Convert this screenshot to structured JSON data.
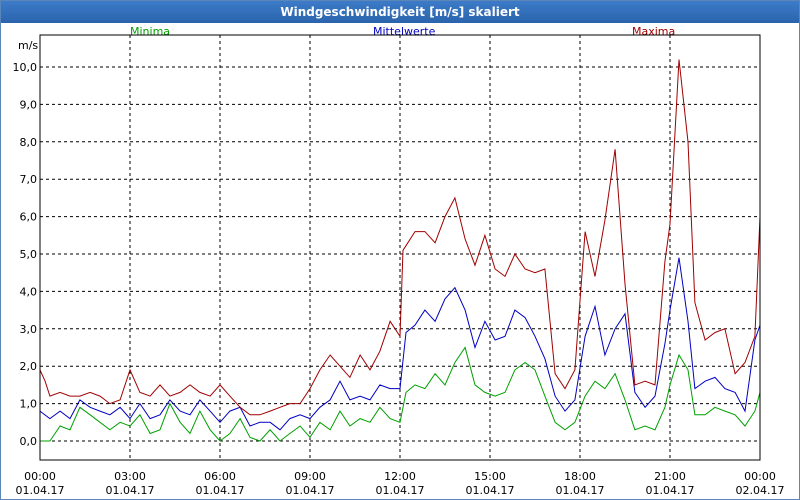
{
  "window": {
    "title": "Windgeschwindigkeit [m/s] skaliert"
  },
  "chart_data": {
    "type": "line",
    "title": "Windgeschwindigkeit [m/s] skaliert",
    "ylabel": "m/s",
    "ylim": [
      0,
      10.5
    ],
    "xlim": [
      0,
      24
    ],
    "yticks": [
      {
        "value": 0,
        "label": "0,0"
      },
      {
        "value": 1,
        "label": "1,0"
      },
      {
        "value": 2,
        "label": "2,0"
      },
      {
        "value": 3,
        "label": "3,0"
      },
      {
        "value": 4,
        "label": "4,0"
      },
      {
        "value": 5,
        "label": "5,0"
      },
      {
        "value": 6,
        "label": "6,0"
      },
      {
        "value": 7,
        "label": "7,0"
      },
      {
        "value": 8,
        "label": "8,0"
      },
      {
        "value": 9,
        "label": "9,0"
      },
      {
        "value": 10,
        "label": "10,0"
      }
    ],
    "xticks": [
      {
        "hour": 0,
        "time": "00:00",
        "date": "01.04.17"
      },
      {
        "hour": 3,
        "time": "03:00",
        "date": "01.04.17"
      },
      {
        "hour": 6,
        "time": "06:00",
        "date": "01.04.17"
      },
      {
        "hour": 9,
        "time": "09:00",
        "date": "01.04.17"
      },
      {
        "hour": 12,
        "time": "12:00",
        "date": "01.04.17"
      },
      {
        "hour": 15,
        "time": "15:00",
        "date": "01.04.17"
      },
      {
        "hour": 18,
        "time": "18:00",
        "date": "01.04.17"
      },
      {
        "hour": 21,
        "time": "21:00",
        "date": "01.04.17"
      },
      {
        "hour": 24,
        "time": "00:00",
        "date": "02.04.17"
      }
    ],
    "grid": true,
    "legend": "top",
    "series": [
      {
        "name": "Minima",
        "color": "#00a000",
        "points": [
          [
            0,
            0.0
          ],
          [
            0.33,
            0.0
          ],
          [
            0.67,
            0.4
          ],
          [
            1.0,
            0.3
          ],
          [
            1.33,
            0.9
          ],
          [
            1.67,
            0.7
          ],
          [
            2.0,
            0.5
          ],
          [
            2.33,
            0.3
          ],
          [
            2.67,
            0.5
          ],
          [
            3.0,
            0.4
          ],
          [
            3.33,
            0.7
          ],
          [
            3.67,
            0.2
          ],
          [
            4.0,
            0.3
          ],
          [
            4.33,
            1.0
          ],
          [
            4.67,
            0.5
          ],
          [
            5.0,
            0.2
          ],
          [
            5.33,
            0.8
          ],
          [
            5.67,
            0.3
          ],
          [
            6.0,
            0.0
          ],
          [
            6.33,
            0.2
          ],
          [
            6.67,
            0.6
          ],
          [
            7.0,
            0.1
          ],
          [
            7.33,
            0.0
          ],
          [
            7.67,
            0.3
          ],
          [
            8.0,
            0.0
          ],
          [
            8.33,
            0.2
          ],
          [
            8.67,
            0.4
          ],
          [
            9.0,
            0.1
          ],
          [
            9.33,
            0.5
          ],
          [
            9.67,
            0.3
          ],
          [
            10.0,
            0.8
          ],
          [
            10.33,
            0.4
          ],
          [
            10.67,
            0.6
          ],
          [
            11.0,
            0.5
          ],
          [
            11.33,
            0.9
          ],
          [
            11.67,
            0.6
          ],
          [
            12.0,
            0.5
          ],
          [
            12.2,
            1.3
          ],
          [
            12.5,
            1.5
          ],
          [
            12.83,
            1.4
          ],
          [
            13.17,
            1.8
          ],
          [
            13.5,
            1.5
          ],
          [
            13.83,
            2.1
          ],
          [
            14.17,
            2.5
          ],
          [
            14.5,
            1.5
          ],
          [
            14.83,
            1.3
          ],
          [
            15.17,
            1.2
          ],
          [
            15.5,
            1.3
          ],
          [
            15.83,
            1.9
          ],
          [
            16.17,
            2.1
          ],
          [
            16.5,
            1.9
          ],
          [
            16.83,
            1.2
          ],
          [
            17.17,
            0.5
          ],
          [
            17.5,
            0.3
          ],
          [
            17.83,
            0.5
          ],
          [
            18.17,
            1.2
          ],
          [
            18.5,
            1.6
          ],
          [
            18.83,
            1.4
          ],
          [
            19.17,
            1.8
          ],
          [
            19.5,
            1.1
          ],
          [
            19.83,
            0.3
          ],
          [
            20.17,
            0.4
          ],
          [
            20.5,
            0.3
          ],
          [
            20.83,
            0.9
          ],
          [
            21.0,
            1.5
          ],
          [
            21.3,
            2.3
          ],
          [
            21.6,
            1.9
          ],
          [
            21.83,
            0.7
          ],
          [
            22.17,
            0.7
          ],
          [
            22.5,
            0.9
          ],
          [
            22.83,
            0.8
          ],
          [
            23.17,
            0.7
          ],
          [
            23.5,
            0.4
          ],
          [
            23.83,
            0.8
          ],
          [
            24.0,
            1.3
          ]
        ]
      },
      {
        "name": "Mittelwerte",
        "color": "#0000c0",
        "points": [
          [
            0,
            0.8
          ],
          [
            0.33,
            0.6
          ],
          [
            0.67,
            0.8
          ],
          [
            1.0,
            0.6
          ],
          [
            1.33,
            1.1
          ],
          [
            1.67,
            0.9
          ],
          [
            2.0,
            0.8
          ],
          [
            2.33,
            0.7
          ],
          [
            2.67,
            0.9
          ],
          [
            3.0,
            0.6
          ],
          [
            3.33,
            1.0
          ],
          [
            3.67,
            0.6
          ],
          [
            4.0,
            0.7
          ],
          [
            4.33,
            1.1
          ],
          [
            4.67,
            0.8
          ],
          [
            5.0,
            0.7
          ],
          [
            5.33,
            1.1
          ],
          [
            5.67,
            0.8
          ],
          [
            6.0,
            0.5
          ],
          [
            6.33,
            0.8
          ],
          [
            6.67,
            0.9
          ],
          [
            7.0,
            0.4
          ],
          [
            7.33,
            0.5
          ],
          [
            7.67,
            0.5
          ],
          [
            8.0,
            0.3
          ],
          [
            8.33,
            0.6
          ],
          [
            8.67,
            0.7
          ],
          [
            9.0,
            0.6
          ],
          [
            9.33,
            0.9
          ],
          [
            9.67,
            1.1
          ],
          [
            10.0,
            1.6
          ],
          [
            10.33,
            1.1
          ],
          [
            10.67,
            1.2
          ],
          [
            11.0,
            1.1
          ],
          [
            11.33,
            1.5
          ],
          [
            11.67,
            1.4
          ],
          [
            12.0,
            1.4
          ],
          [
            12.2,
            2.9
          ],
          [
            12.5,
            3.1
          ],
          [
            12.83,
            3.5
          ],
          [
            13.17,
            3.2
          ],
          [
            13.5,
            3.8
          ],
          [
            13.83,
            4.1
          ],
          [
            14.17,
            3.5
          ],
          [
            14.5,
            2.5
          ],
          [
            14.83,
            3.2
          ],
          [
            15.17,
            2.7
          ],
          [
            15.5,
            2.8
          ],
          [
            15.83,
            3.5
          ],
          [
            16.17,
            3.3
          ],
          [
            16.5,
            2.8
          ],
          [
            16.83,
            2.2
          ],
          [
            17.17,
            1.2
          ],
          [
            17.5,
            0.8
          ],
          [
            17.83,
            1.1
          ],
          [
            18.17,
            2.8
          ],
          [
            18.5,
            3.6
          ],
          [
            18.83,
            2.3
          ],
          [
            19.17,
            3.0
          ],
          [
            19.5,
            3.4
          ],
          [
            19.83,
            1.3
          ],
          [
            20.17,
            0.9
          ],
          [
            20.5,
            1.2
          ],
          [
            20.83,
            2.6
          ],
          [
            21.0,
            3.5
          ],
          [
            21.3,
            4.9
          ],
          [
            21.6,
            3.2
          ],
          [
            21.83,
            1.4
          ],
          [
            22.17,
            1.6
          ],
          [
            22.5,
            1.7
          ],
          [
            22.83,
            1.4
          ],
          [
            23.17,
            1.3
          ],
          [
            23.5,
            0.8
          ],
          [
            23.83,
            2.7
          ],
          [
            24.0,
            3.1
          ]
        ]
      },
      {
        "name": "Maxima",
        "color": "#a00000",
        "points": [
          [
            0,
            1.9
          ],
          [
            0.17,
            1.6
          ],
          [
            0.33,
            1.2
          ],
          [
            0.67,
            1.3
          ],
          [
            1.0,
            1.2
          ],
          [
            1.33,
            1.2
          ],
          [
            1.67,
            1.3
          ],
          [
            2.0,
            1.2
          ],
          [
            2.33,
            1.0
          ],
          [
            2.67,
            1.1
          ],
          [
            3.0,
            1.9
          ],
          [
            3.33,
            1.3
          ],
          [
            3.67,
            1.2
          ],
          [
            4.0,
            1.5
          ],
          [
            4.33,
            1.2
          ],
          [
            4.67,
            1.3
          ],
          [
            5.0,
            1.5
          ],
          [
            5.33,
            1.3
          ],
          [
            5.67,
            1.2
          ],
          [
            6.0,
            1.5
          ],
          [
            6.33,
            1.2
          ],
          [
            6.67,
            0.9
          ],
          [
            7.0,
            0.7
          ],
          [
            7.33,
            0.7
          ],
          [
            7.67,
            0.8
          ],
          [
            8.0,
            0.9
          ],
          [
            8.33,
            1.0
          ],
          [
            8.67,
            1.0
          ],
          [
            9.0,
            1.4
          ],
          [
            9.33,
            1.9
          ],
          [
            9.67,
            2.3
          ],
          [
            10.0,
            2.0
          ],
          [
            10.33,
            1.7
          ],
          [
            10.67,
            2.3
          ],
          [
            11.0,
            1.9
          ],
          [
            11.33,
            2.4
          ],
          [
            11.67,
            3.2
          ],
          [
            12.0,
            2.8
          ],
          [
            12.1,
            5.1
          ],
          [
            12.5,
            5.6
          ],
          [
            12.83,
            5.6
          ],
          [
            13.17,
            5.3
          ],
          [
            13.5,
            6.0
          ],
          [
            13.83,
            6.5
          ],
          [
            14.17,
            5.4
          ],
          [
            14.5,
            4.7
          ],
          [
            14.83,
            5.5
          ],
          [
            15.17,
            4.6
          ],
          [
            15.5,
            4.4
          ],
          [
            15.83,
            5.0
          ],
          [
            16.17,
            4.6
          ],
          [
            16.5,
            4.5
          ],
          [
            16.83,
            4.6
          ],
          [
            17.17,
            1.8
          ],
          [
            17.5,
            1.4
          ],
          [
            17.83,
            1.9
          ],
          [
            18.17,
            5.6
          ],
          [
            18.5,
            4.4
          ],
          [
            18.83,
            5.9
          ],
          [
            19.17,
            7.8
          ],
          [
            19.5,
            4.2
          ],
          [
            19.83,
            1.5
          ],
          [
            20.17,
            1.6
          ],
          [
            20.5,
            1.5
          ],
          [
            20.83,
            4.8
          ],
          [
            21.0,
            5.8
          ],
          [
            21.3,
            10.2
          ],
          [
            21.6,
            8.0
          ],
          [
            21.83,
            3.7
          ],
          [
            22.17,
            2.7
          ],
          [
            22.5,
            2.9
          ],
          [
            22.83,
            3.0
          ],
          [
            23.17,
            1.8
          ],
          [
            23.5,
            2.1
          ],
          [
            23.83,
            2.8
          ],
          [
            24.0,
            6.0
          ]
        ]
      }
    ]
  }
}
